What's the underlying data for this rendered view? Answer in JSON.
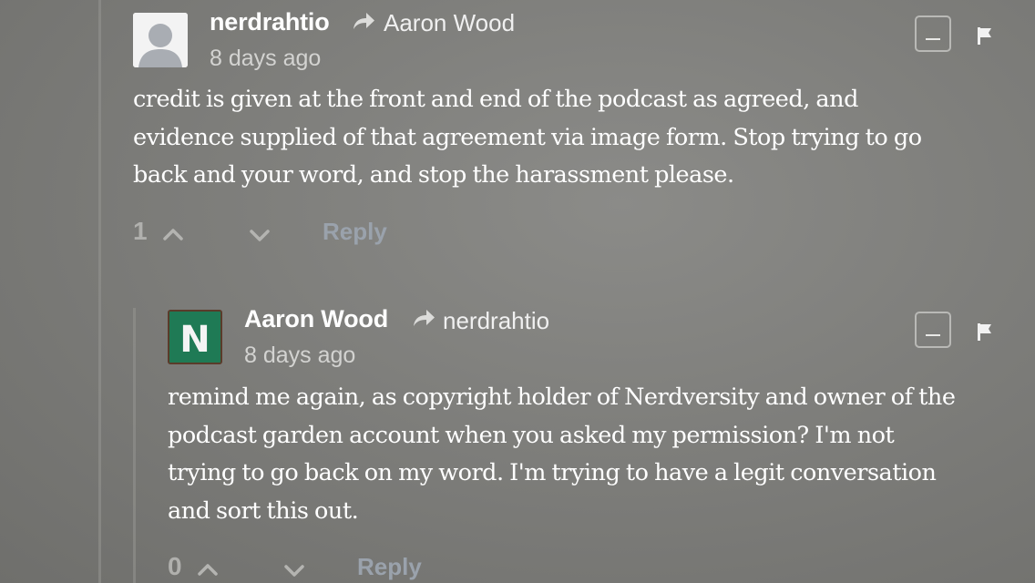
{
  "comments": [
    {
      "author": "nerdrahtio",
      "reply_to": "Aaron Wood",
      "time": "8 days ago",
      "body": [
        "credit is given at the front and end of the podcast as agreed, and",
        "evidence supplied of that agreement via image form. Stop trying to go",
        "back and your word, and stop the harassment please."
      ],
      "votes": "1",
      "reply_label": "Reply",
      "avatar": "default-avatar-icon"
    },
    {
      "author": "Aaron Wood",
      "reply_to": "nerdrahtio",
      "time": "8 days ago",
      "body": [
        "remind me again, as copyright holder of Nerdversity and owner of the",
        "podcast garden account when you asked my permission? I'm not",
        "trying to go back on my word. I'm trying to have a legit conversation",
        "and sort this out."
      ],
      "votes": "0",
      "reply_label": "Reply",
      "avatar_letter": "N"
    }
  ],
  "colors": {
    "background": "#7e7e7b",
    "text": "#ffffff",
    "muted": "#d3d3d1",
    "reply_link": "#9aa2ac",
    "avatar_green": "#1f7a55"
  }
}
